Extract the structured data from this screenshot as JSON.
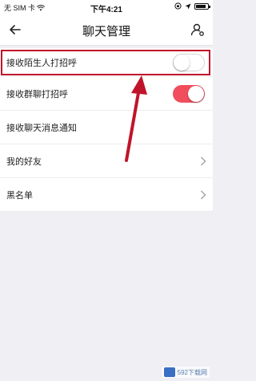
{
  "status_bar": {
    "carrier": "无 SIM 卡",
    "time": "下午4:21",
    "battery_level": 0.85
  },
  "nav": {
    "title": "聊天管理",
    "back_icon": "back-arrow-icon",
    "right_icon": "user-settings-icon"
  },
  "settings": {
    "items": [
      {
        "label": "接收陌生人打招呼",
        "control": "toggle",
        "state": "off"
      },
      {
        "label": "接收群聊打招呼",
        "control": "toggle",
        "state": "on"
      },
      {
        "label": "接收聊天消息通知",
        "control": "none"
      },
      {
        "label": "我的好友",
        "control": "chevron"
      },
      {
        "label": "黑名单",
        "control": "chevron"
      }
    ]
  },
  "annotation": {
    "highlight_color": "#c0142a",
    "arrow_color": "#c0142a"
  },
  "watermark": {
    "text": "592下载网"
  },
  "colors": {
    "toggle_on": "#f04e5d",
    "background": "#efeff4"
  }
}
